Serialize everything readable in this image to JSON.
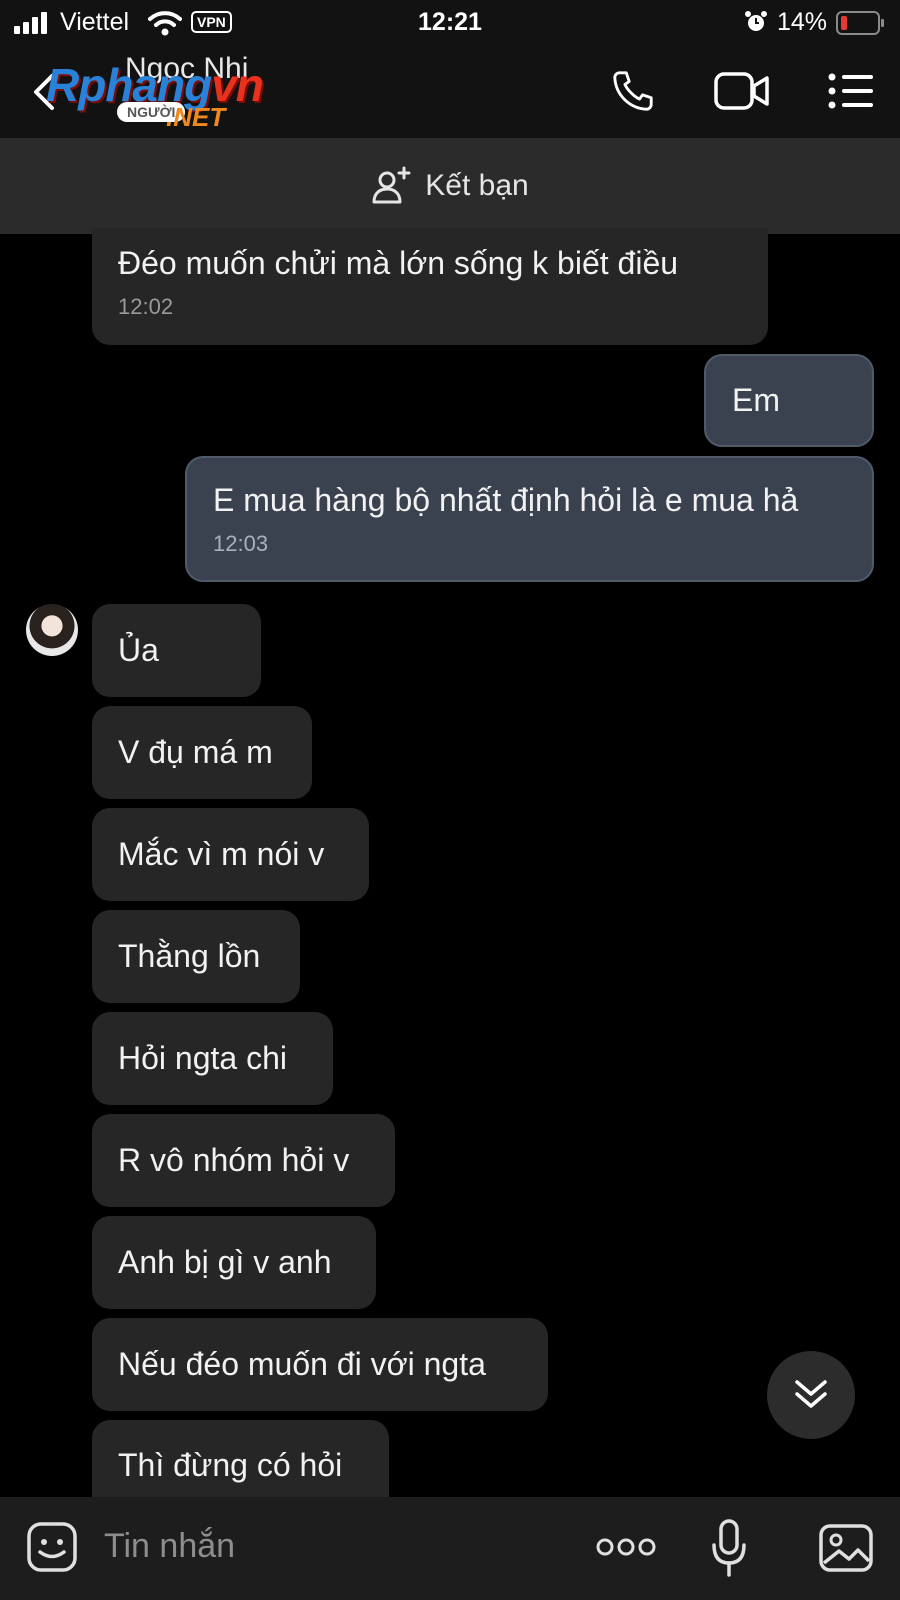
{
  "status_bar": {
    "carrier": "Viettel",
    "vpn": "VPN",
    "time": "12:21",
    "battery": "14%"
  },
  "header": {
    "contact_name": "Ngọc Nhi",
    "watermark": {
      "main_a": "Rphang",
      "main_b": "vn",
      "tag": "NGƯỜI",
      "net": ".NET"
    }
  },
  "friend_bar": {
    "label": "Kết bạn"
  },
  "messages": [
    {
      "side": "in",
      "text": "Đéo muốn chửi mà lớn sống k biết điều",
      "time": "12:02"
    },
    {
      "side": "out",
      "text": "Em"
    },
    {
      "side": "out",
      "text": "E mua hàng bộ nhất định hỏi là e mua hả",
      "time": "12:03"
    },
    {
      "side": "in",
      "text": "Ủa"
    },
    {
      "side": "in",
      "text": "V đụ má m"
    },
    {
      "side": "in",
      "text": "Mắc vì m nói v"
    },
    {
      "side": "in",
      "text": "Thằng lồn"
    },
    {
      "side": "in",
      "text": "Hỏi ngta chi"
    },
    {
      "side": "in",
      "text": "R vô nhóm hỏi v"
    },
    {
      "side": "in",
      "text": "Anh bị gì v anh"
    },
    {
      "side": "in",
      "text": "Nếu đéo muốn đi với ngta"
    },
    {
      "side": "in",
      "text": "Thì đừng có hỏi"
    }
  ],
  "composer": {
    "placeholder": "Tin nhắn"
  },
  "colors": {
    "background": "#000000",
    "incoming_bubble": "#262626",
    "outgoing_bubble": "#3a4250",
    "battery_low": "#e53935"
  }
}
